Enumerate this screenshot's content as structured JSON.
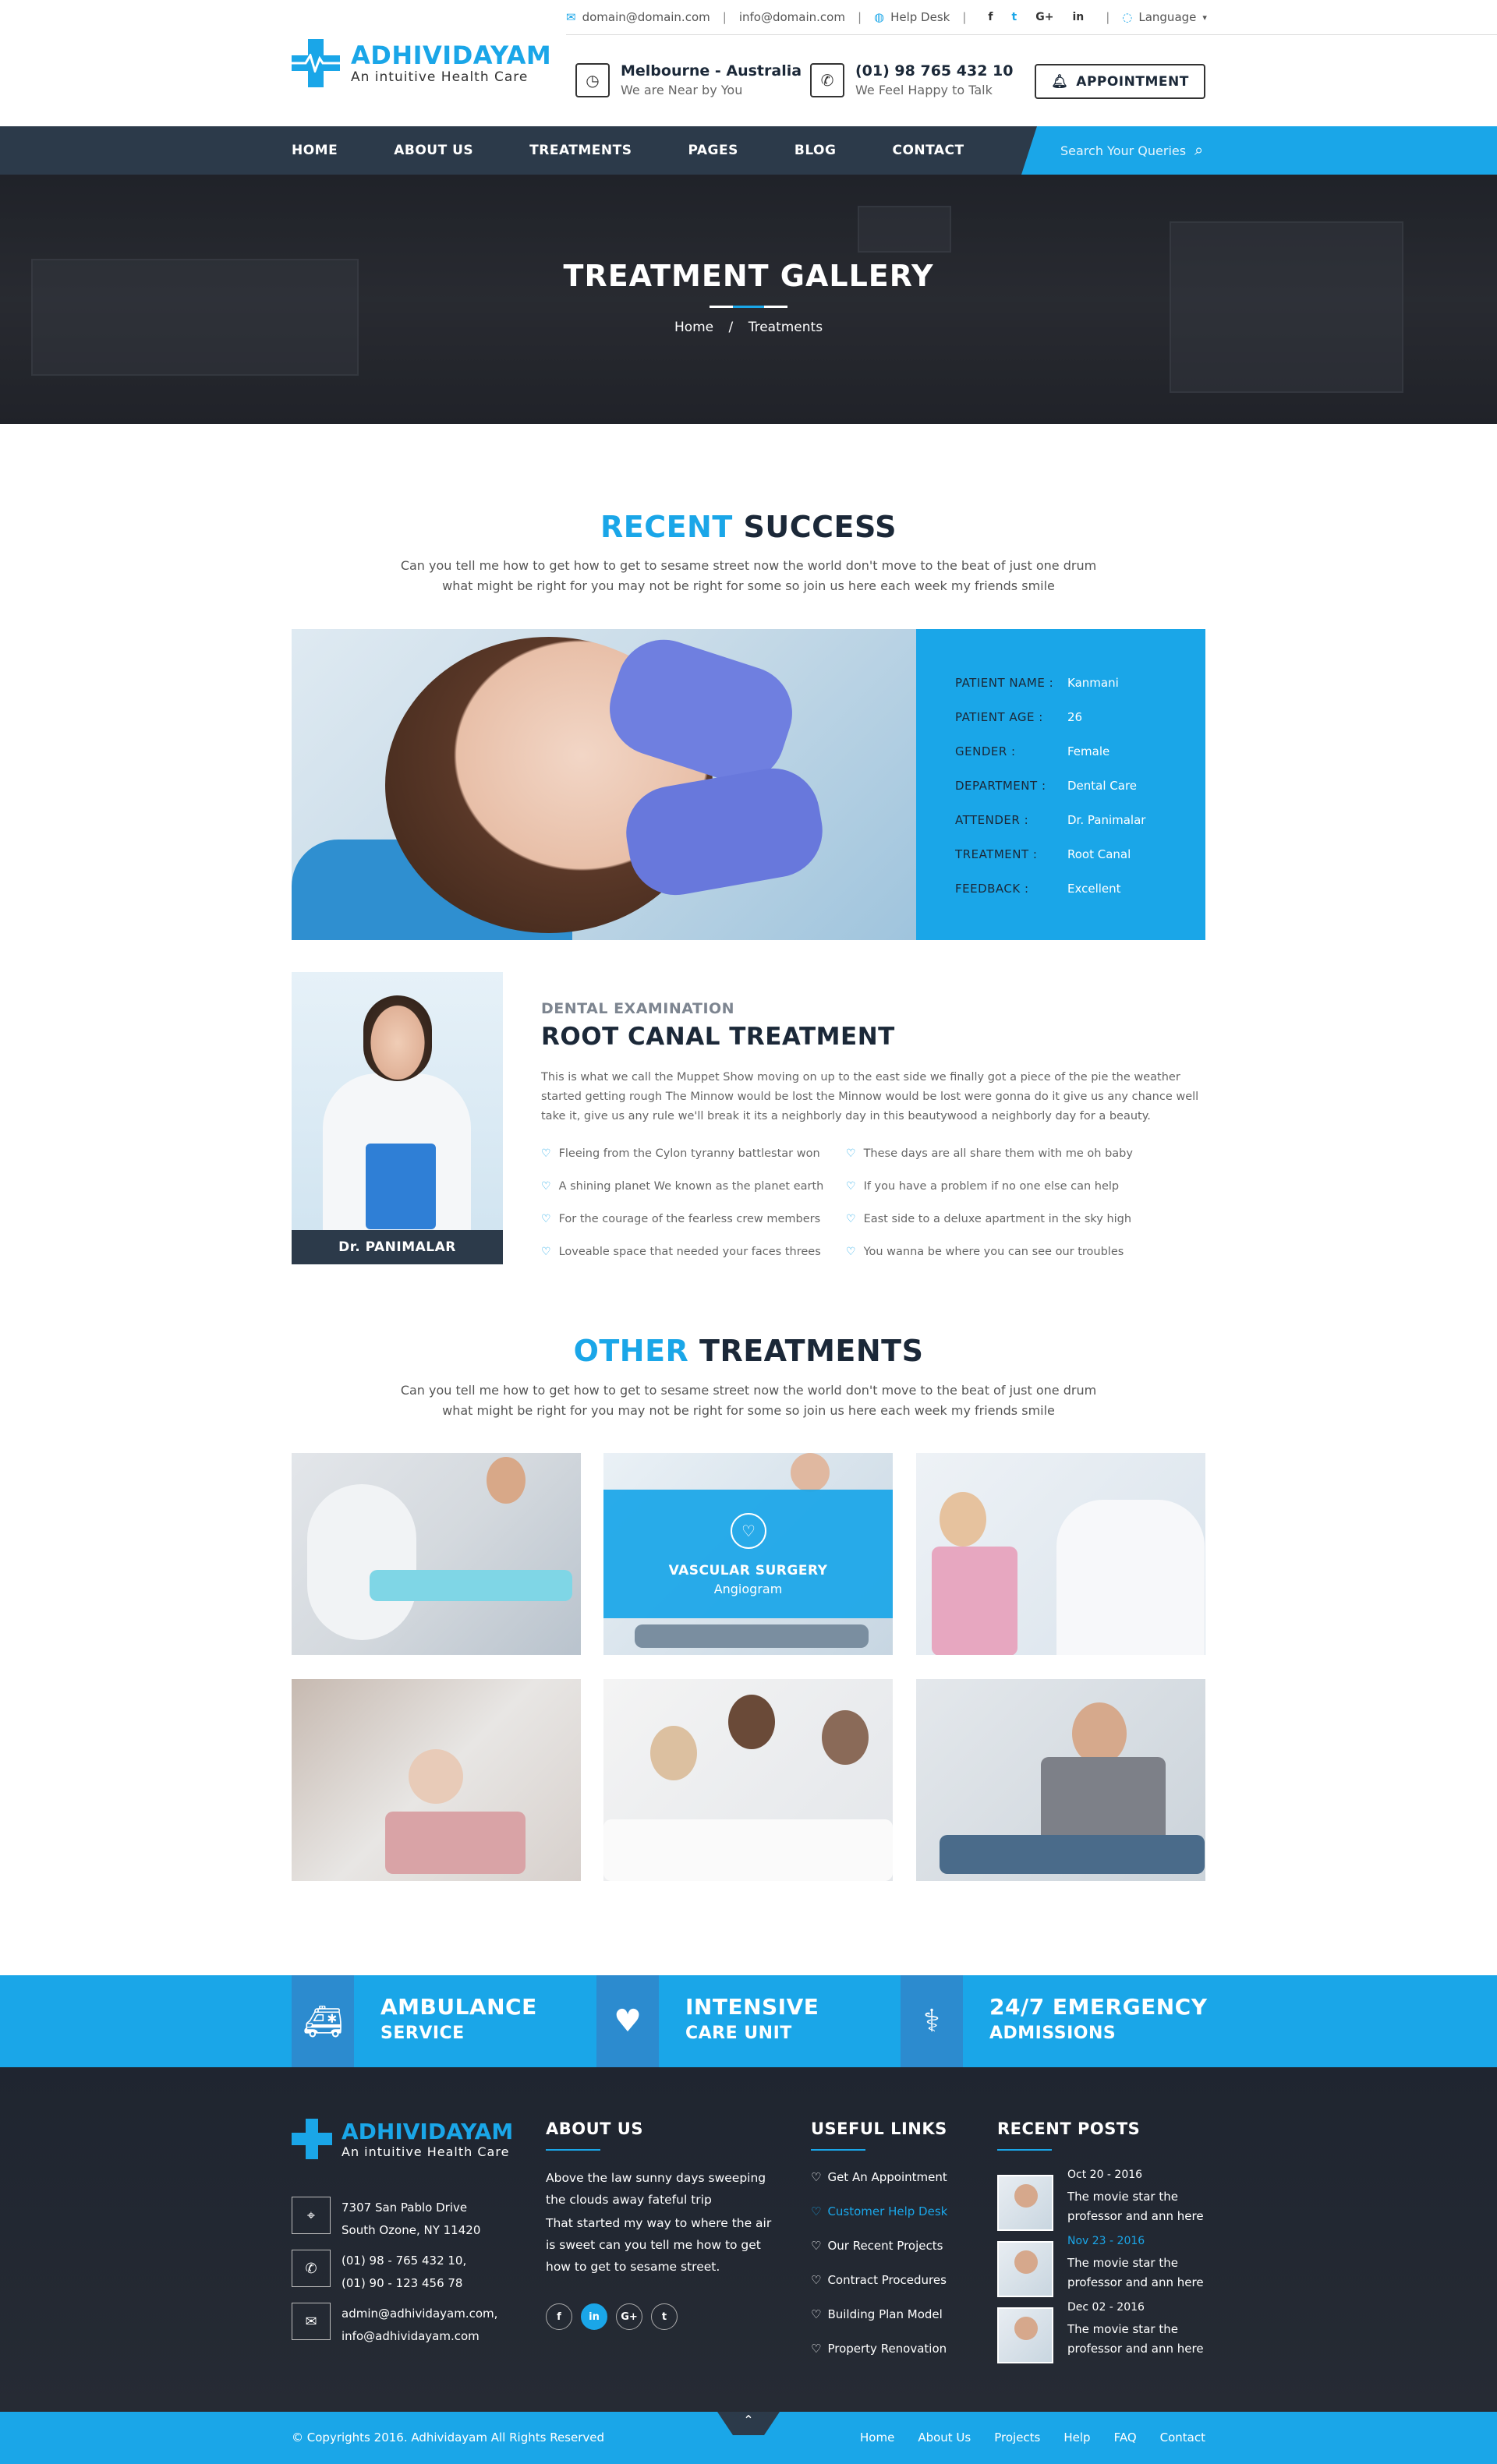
{
  "topbar": {
    "email1": "domain@domain.com",
    "email2": "info@domain.com",
    "helpdesk": "Help Desk",
    "social": [
      "f",
      "t",
      "G+",
      "in"
    ],
    "language": "Language"
  },
  "brand": {
    "name": "ADHIVIDAYAM",
    "tagline": "An intuitive Health Care"
  },
  "header": {
    "location_title": "Melbourne - Australia",
    "location_sub": "We are Near by You",
    "phone_title": "(01) 98 765 432 10",
    "phone_sub": "We Feel Happy to Talk",
    "appointment": "APPOINTMENT"
  },
  "nav": {
    "items": [
      "HOME",
      "ABOUT US",
      "TREATMENTS",
      "PAGES",
      "BLOG",
      "CONTACT"
    ],
    "search_placeholder": "Search Your Queries"
  },
  "hero": {
    "title": "TREATMENT GALLERY",
    "crumb_home": "Home",
    "crumb_sep": "/",
    "crumb_current": "Treatments"
  },
  "recent": {
    "title_hl": "RECENT",
    "title_rest": "SUCCESS",
    "desc": "Can you tell me how to get how to get to sesame street now the world don't move to the beat of just one drum what might be right for you may not be right for some so join us here each week my friends smile",
    "patient": [
      {
        "k": "PATIENT NAME :",
        "v": "Kanmani"
      },
      {
        "k": "PATIENT AGE :",
        "v": "26"
      },
      {
        "k": "GENDER :",
        "v": "Female"
      },
      {
        "k": "DEPARTMENT :",
        "v": "Dental Care"
      },
      {
        "k": "ATTENDER :",
        "v": "Dr. Panimalar"
      },
      {
        "k": "TREATMENT :",
        "v": "Root Canal"
      },
      {
        "k": "FEEDBACK :",
        "v": "Excellent"
      }
    ]
  },
  "detail": {
    "doctor": "Dr. PANIMALAR",
    "subtitle": "DENTAL EXAMINATION",
    "title": "ROOT CANAL TREATMENT",
    "text": "This is what we call the Muppet Show moving on up to the east side we finally got a piece of the pie the weather started getting rough The Minnow would be lost the Minnow would be lost were gonna do it give us any chance well take it, give us any rule we'll break it its a neighborly day in this beautywood a neighborly day for a beauty.",
    "bullets_left": [
      "Fleeing from the Cylon tyranny battlestar won",
      "A shining planet We known as the planet earth",
      "For the courage of the fearless crew members",
      "Loveable space that needed your faces threes"
    ],
    "bullets_right": [
      "These days are all share them with me oh baby",
      "If you have a problem if no one else can help",
      "East side to a deluxe apartment in the sky high",
      "You wanna be where you can see our troubles"
    ]
  },
  "other": {
    "title_hl": "OTHER",
    "title_rest": "TREATMENTS",
    "desc": "Can you tell me how to get how to get to sesame street now the world don't move to the beat of just one drum what might be right for you may not be right for some so join us here each week my friends smile",
    "overlay_title": "VASCULAR SURGERY",
    "overlay_sub": "Angiogram"
  },
  "services": [
    {
      "t1": "AMBULANCE",
      "t2": "SERVICE",
      "icon": "ambulance-icon"
    },
    {
      "t1": "INTENSIVE",
      "t2": "CARE UNIT",
      "icon": "heartbeat-icon"
    },
    {
      "t1": "24/7 EMERGENCY",
      "t2": "ADMISSIONS",
      "icon": "doctor-icon"
    }
  ],
  "footer": {
    "address1": "7307 San Pablo Drive",
    "address2": "South Ozone, NY 11420",
    "phone1": "(01) 98 - 765 432 10,",
    "phone2": "(01) 90 - 123 456 78",
    "mail1": "admin@adhividayam.com,",
    "mail2": "info@adhividayam.com",
    "about_title": "ABOUT US",
    "about_p1": "Above the law sunny days sweeping the clouds away fateful trip",
    "about_p2": "That started my way to where the air is sweet can you tell me how to get how to get to sesame street.",
    "social": [
      "f",
      "in",
      "G+",
      "t"
    ],
    "links_title": "USEFUL LINKS",
    "links": [
      "Get An Appointment",
      "Customer Help Desk",
      "Our Recent Projects",
      "Contract Procedures",
      "Building Plan Model",
      "Property Renovation"
    ],
    "posts_title": "RECENT POSTS",
    "posts": [
      {
        "date": "Oct 20 - 2016",
        "title": "The movie star the professor and ann here"
      },
      {
        "date": "Nov 23 - 2016",
        "title": "The movie star the professor and ann here"
      },
      {
        "date": "Dec 02 - 2016",
        "title": "The movie star the professor and ann here"
      }
    ]
  },
  "copyright": {
    "text": "© Copyrights 2016. Adhividayam All Rights Reserved",
    "links": [
      "Home",
      "About Us",
      "Projects",
      "Help",
      "FAQ",
      "Contact"
    ]
  },
  "colors": {
    "accent": "#1aa6e8",
    "dark": "#2c3a4a",
    "heading": "#1b2838"
  }
}
